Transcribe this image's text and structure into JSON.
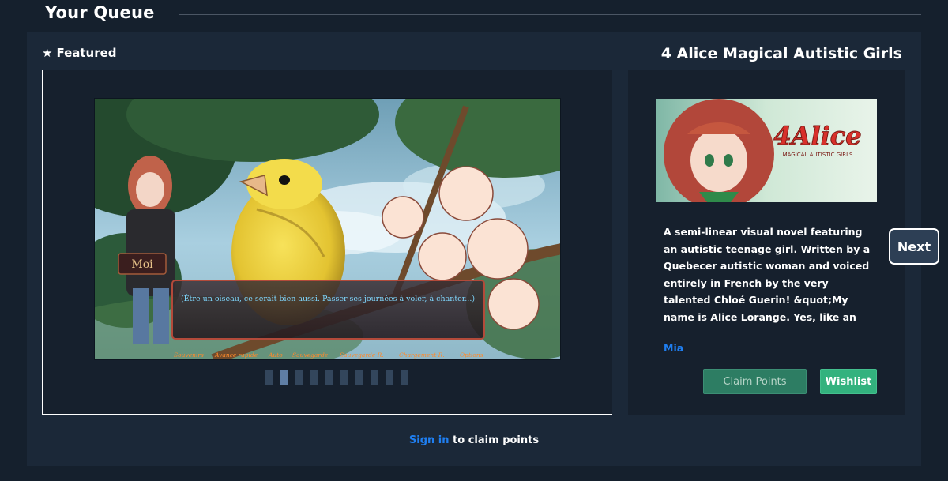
{
  "header": {
    "title": "Your Queue"
  },
  "featured": {
    "star": "★",
    "label": "Featured"
  },
  "game": {
    "title": "4 Alice Magical Autistic Girls",
    "description": "A semi-linear visual novel featuring an autistic teenage girl. Written by a Quebecer autistic woman and voiced entirely in French by the very talented Chloé Guerin! &quot;My name is Alice Lorange. Yes, like an orange.&quot; As the title suggests, thi...",
    "developer": "Mia",
    "capsule": {
      "logo_text": "4Alice",
      "logo_subtitle": "MAGICAL AUTISTIC GIRLS"
    }
  },
  "screenshot": {
    "speaker": "Moi",
    "dialogue": "(Être un oiseau, ce serait bien aussi. Passer ses journées à voler, à chanter...)",
    "menu": [
      "Souvenirs",
      "Avance rapide",
      "Auto",
      "Sauvegarde",
      "Sauvegarde R.",
      "Chargement R.",
      "Options"
    ]
  },
  "carousel": {
    "count": 10,
    "active_index": 1
  },
  "buttons": {
    "claim": "Claim Points",
    "wishlist": "Wishlist",
    "next": "Next"
  },
  "signin": {
    "link": "Sign in",
    "rest": " to claim points"
  },
  "colors": {
    "background": "#15202d",
    "panel": "#1b2838",
    "link": "#1f7ef0",
    "wishlist": "#33b27e",
    "claim": "#2d7d63"
  }
}
